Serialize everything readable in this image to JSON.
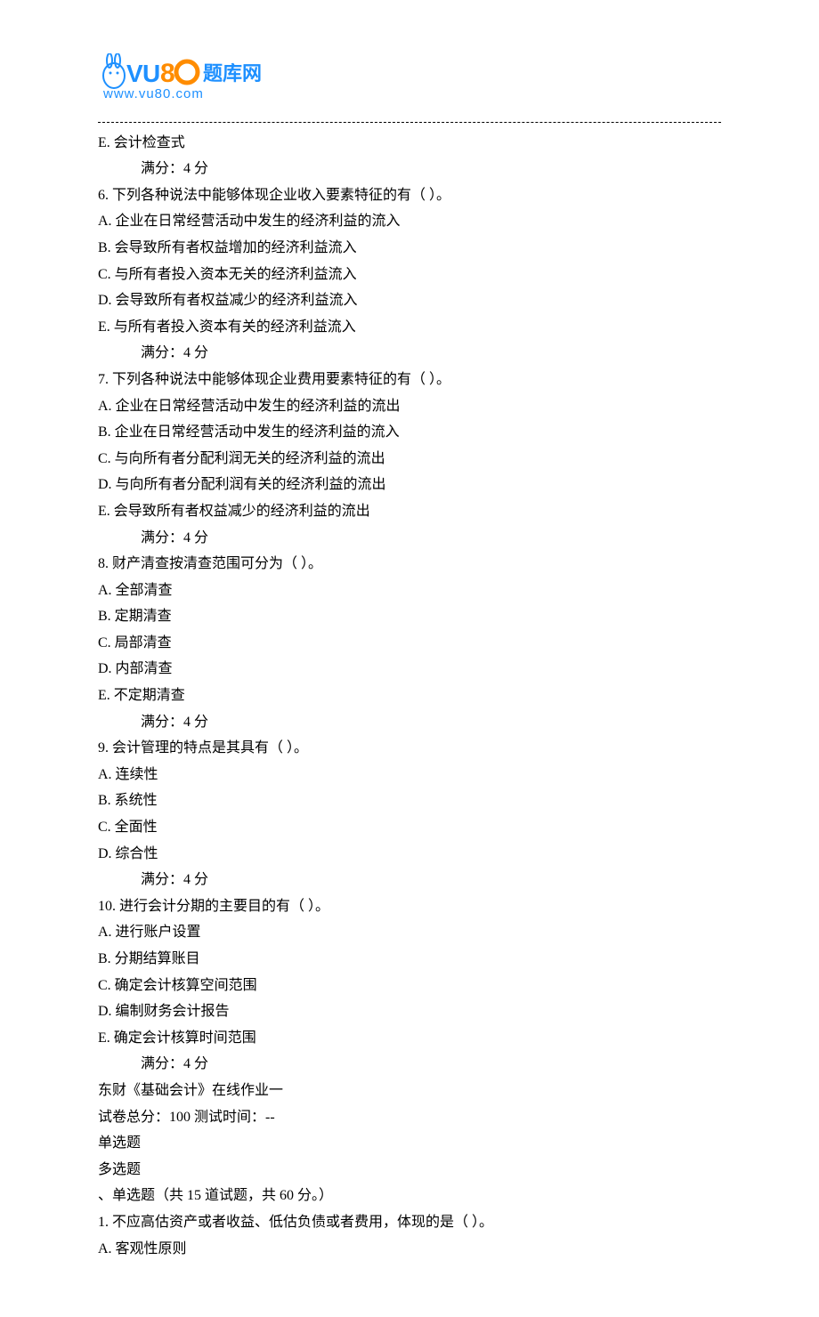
{
  "logo": {
    "text_cn": "题库网",
    "url": "www.vu80.com",
    "blue": "#1e90ff",
    "orange": "#ff8c00"
  },
  "lines": {
    "l1": "E.  会计检查式",
    "l2": "满分：4   分",
    "l3": "6.   下列各种说法中能够体现企业收入要素特征的有（ ）。",
    "l4": "A.  企业在日常经营活动中发生的经济利益的流入",
    "l5": "B.  会导致所有者权益增加的经济利益流入",
    "l6": "C.  与所有者投入资本无关的经济利益流入",
    "l7": "D.  会导致所有者权益减少的经济利益流入",
    "l8": "E.  与所有者投入资本有关的经济利益流入",
    "l9": "满分：4   分",
    "l10": "7.   下列各种说法中能够体现企业费用要素特征的有（ ）。",
    "l11": "A.  企业在日常经营活动中发生的经济利益的流出",
    "l12": "B.  企业在日常经营活动中发生的经济利益的流入",
    "l13": "C.  与向所有者分配利润无关的经济利益的流出",
    "l14": "D.  与向所有者分配利润有关的经济利益的流出",
    "l15": "E.  会导致所有者权益减少的经济利益的流出",
    "l16": "满分：4   分",
    "l17": "8.   财产清查按清查范围可分为（ ）。",
    "l18": "A.  全部清查",
    "l19": "B.  定期清查",
    "l20": "C.  局部清查",
    "l21": "D.  内部清查",
    "l22": "E.  不定期清查",
    "l23": "满分：4   分",
    "l24": "9.   会计管理的特点是其具有（ ）。",
    "l25": "A.  连续性",
    "l26": "B.  系统性",
    "l27": "C.  全面性",
    "l28": "D.  综合性",
    "l29": "满分：4   分",
    "l30": "10.   进行会计分期的主要目的有（ ）。",
    "l31": "A.  进行账户设置",
    "l32": "B.  分期结算账目",
    "l33": "C.  确定会计核算空间范围",
    "l34": "D.  编制财务会计报告",
    "l35": "E.  确定会计核算时间范围",
    "l36": "满分：4   分",
    "l37": "东财《基础会计》在线作业一",
    "l38": "试卷总分：100           测试时间：--",
    "l39": "单选题",
    "l40": "多选题",
    "l41": "、单选题（共 15 道试题，共 60 分。）",
    "l42": "1.   不应高估资产或者收益、低估负债或者费用，体现的是（ ）。",
    "l43": "A.  客观性原则"
  }
}
